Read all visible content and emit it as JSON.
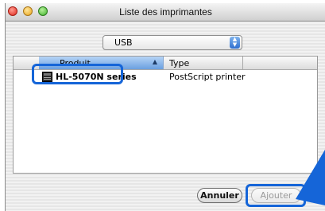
{
  "window": {
    "title": "Liste des imprimantes"
  },
  "connection_popup": {
    "selected": "USB"
  },
  "printer_list": {
    "columns": [
      "Produit",
      "Type"
    ],
    "rows": [
      {
        "name": "HL-5070N series",
        "type": "PostScript printer"
      }
    ]
  },
  "buttons": {
    "cancel": "Annuler",
    "add": "Ajouter"
  },
  "icons": [
    "close-icon",
    "minimize-icon",
    "zoom-icon",
    "popup-arrows-icon",
    "sort-ascending-icon",
    "printer-icon",
    "pointer-arrow-icon"
  ],
  "colors": {
    "highlight": "#1565d8",
    "column_header_selected": "#6a9fe0"
  }
}
